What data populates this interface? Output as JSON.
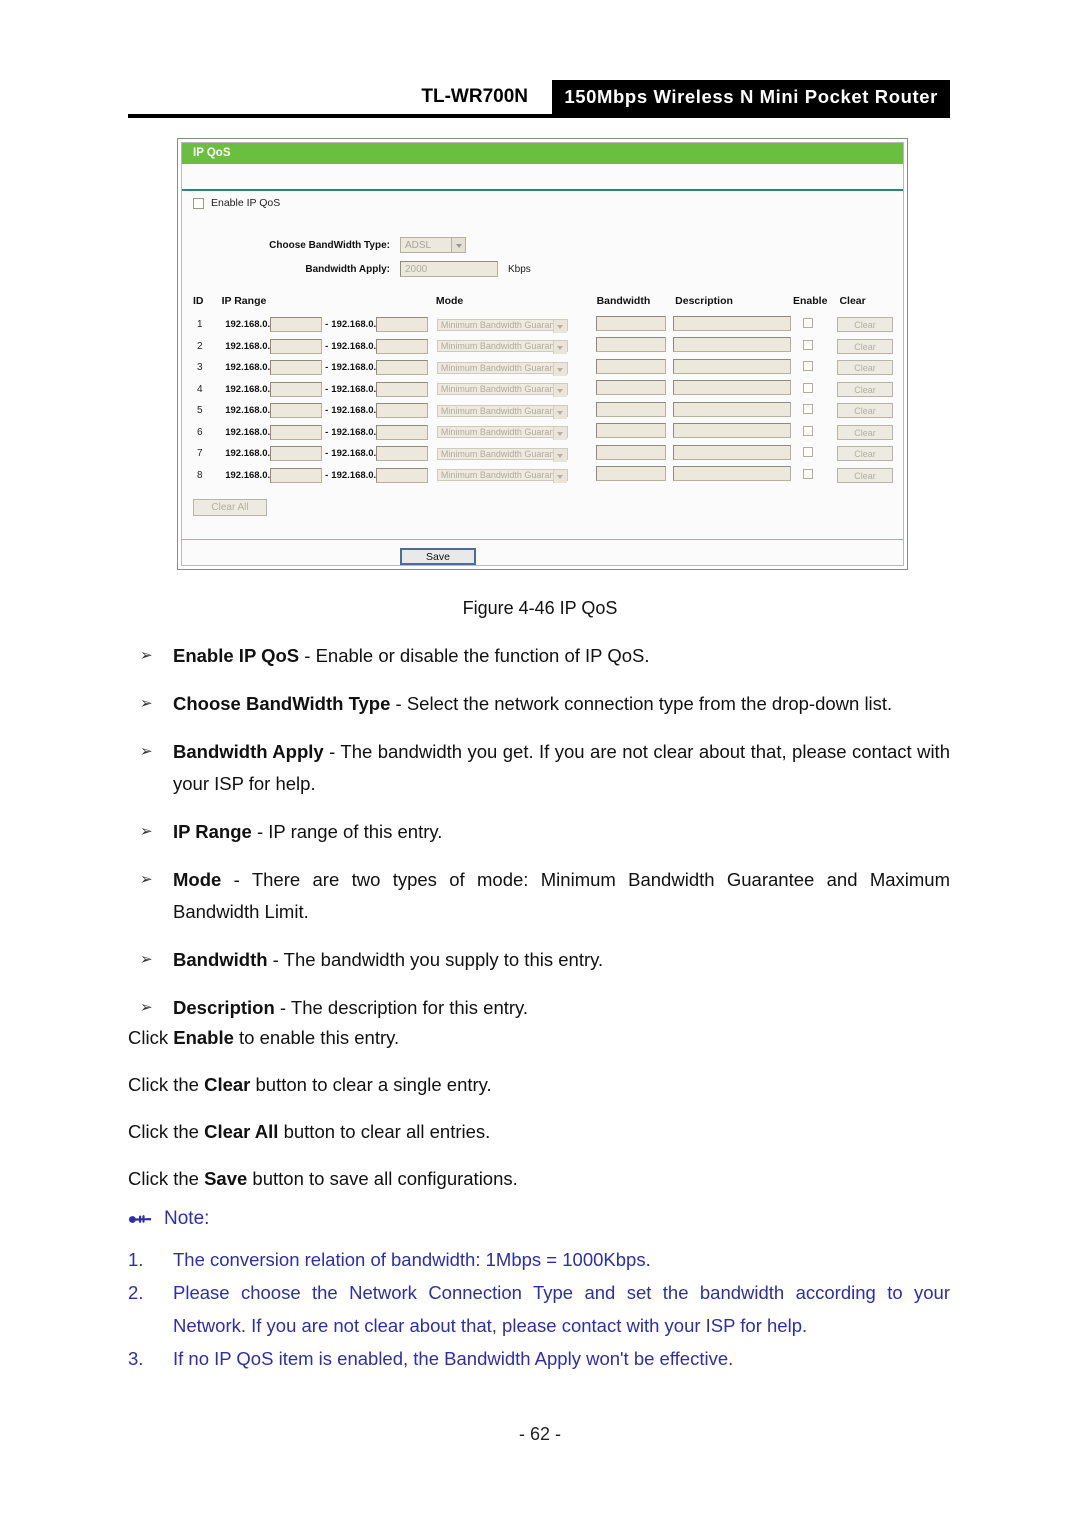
{
  "header": {
    "model": "TL-WR700N",
    "product": "150Mbps Wireless N Mini Pocket Router"
  },
  "screenshot": {
    "panel_title": "IP QoS",
    "enable_checkbox_label": "Enable IP QoS",
    "bandwidth_type_label": "Choose BandWidth Type:",
    "bandwidth_type_value": "ADSL",
    "bandwidth_apply_label": "Bandwidth Apply:",
    "bandwidth_apply_value": "2000",
    "bandwidth_unit": "Kbps",
    "columns": {
      "id": "ID",
      "ip_range": "IP Range",
      "mode": "Mode",
      "bandwidth": "Bandwidth",
      "description": "Description",
      "enable": "Enable",
      "clear": "Clear"
    },
    "ip_prefix": "192.168.0.",
    "range_separator": "-",
    "mode_value": "Minimum Bandwidth Guarantee",
    "row_clear_label": "Clear",
    "rows": [
      {
        "id": "1"
      },
      {
        "id": "2"
      },
      {
        "id": "3"
      },
      {
        "id": "4"
      },
      {
        "id": "5"
      },
      {
        "id": "6"
      },
      {
        "id": "7"
      },
      {
        "id": "8"
      }
    ],
    "clear_all_label": "Clear All",
    "save_label": "Save",
    "colors": {
      "panel_header": "#6bbf40",
      "divider": "#2e8573",
      "field_fill": "#ece8dc"
    }
  },
  "figure_caption": "Figure 4-46 IP QoS",
  "bullets": [
    {
      "marker": "➢",
      "term": "Enable IP QoS",
      "sep": " - ",
      "text": "Enable or disable the function of IP QoS."
    },
    {
      "marker": "➢",
      "term": "Choose BandWidth Type",
      "sep": " - ",
      "text": "Select the network connection type from the drop-down list."
    },
    {
      "marker": "➢",
      "term": "Bandwidth Apply",
      "sep": " - ",
      "text": "The bandwidth you get. If you are not clear about that, please contact with your ISP for help."
    },
    {
      "marker": "➢",
      "term": "IP Range",
      "sep": " - ",
      "text": "IP range of this entry."
    },
    {
      "marker": "➢",
      "term": "Mode",
      "sep": " - ",
      "text": "There are two types of mode: Minimum Bandwidth Guarantee and Maximum Bandwidth Limit."
    },
    {
      "marker": "➢",
      "term": "Bandwidth",
      "sep": " - ",
      "text": "The bandwidth you supply to this entry."
    },
    {
      "marker": "➢",
      "term": "Description",
      "sep": " - ",
      "text": "The description for this entry."
    }
  ],
  "click_lines": [
    {
      "pre": "Click ",
      "term": "Enable",
      "post": " to enable this entry."
    },
    {
      "pre": "Click the ",
      "term": "Clear",
      "post": " button to clear a single entry."
    },
    {
      "pre": "Click the ",
      "term": "Clear All",
      "post": " button to clear all entries."
    },
    {
      "pre": "Click the ",
      "term": "Save",
      "post": " button to save all configurations."
    }
  ],
  "note": {
    "icon": "pointing-hand-icon",
    "label": "Note:",
    "color": "#2e2ea8",
    "items": [
      {
        "num": "1.",
        "text": "The conversion relation of bandwidth: 1Mbps = 1000Kbps."
      },
      {
        "num": "2.",
        "text": "Please choose the Network Connection Type and set the bandwidth according to your Network. If you are not clear about that, please contact with your ISP for help."
      },
      {
        "num": "3.",
        "text": "If no IP QoS item is enabled, the Bandwidth Apply won't be effective."
      }
    ]
  },
  "page_number": "- 62 -"
}
